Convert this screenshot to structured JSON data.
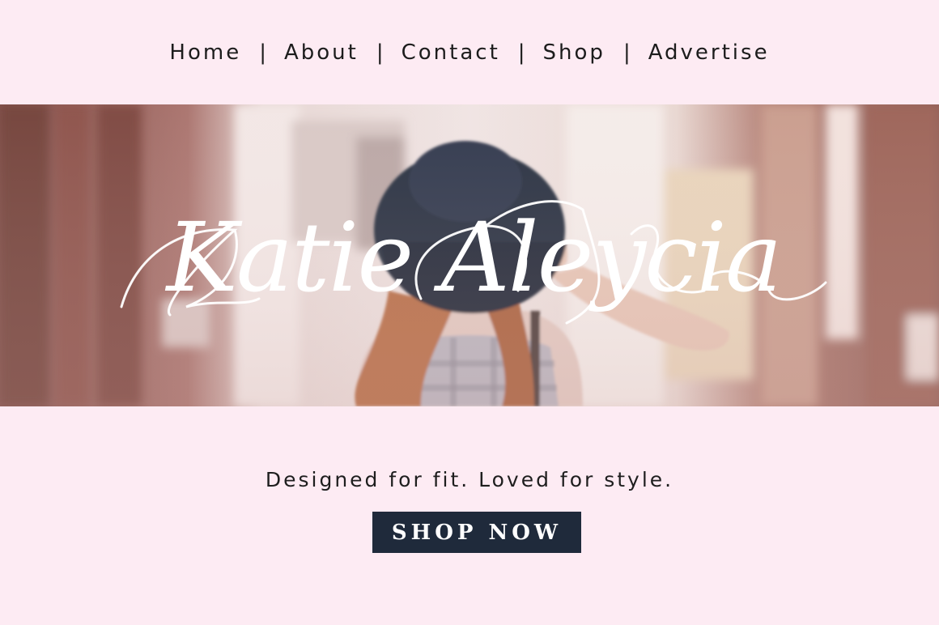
{
  "nav": {
    "items": [
      "Home",
      "About",
      "Contact",
      "Shop",
      "Advertise"
    ],
    "separator": "|"
  },
  "hero": {
    "logo_text": "Katie Aleycia",
    "image": "woman-in-black-hat-photo"
  },
  "tagline": "Designed for fit. Loved for style.",
  "cta": {
    "label": "SHOP NOW"
  },
  "colors": {
    "background": "#fdebf3",
    "button": "#1f2a3b",
    "text": "#1c1c1c",
    "logo": "#ffffff"
  }
}
